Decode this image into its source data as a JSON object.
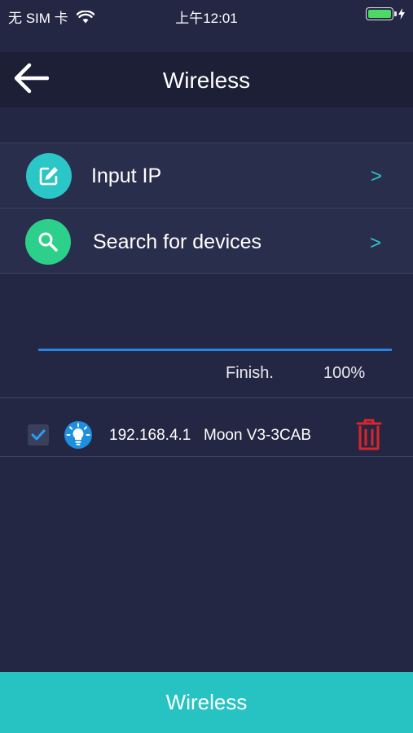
{
  "status_bar": {
    "carrier": "无 SIM 卡",
    "time": "上午12:01",
    "battery_level": 1.0
  },
  "header": {
    "title": "Wireless",
    "back_icon": "arrow-left-icon"
  },
  "menu": [
    {
      "label": "Input IP",
      "icon": "edit-icon",
      "chevron": ">",
      "color": "#2bc6c8"
    },
    {
      "label": "Search for devices",
      "icon": "search-icon",
      "chevron": ">",
      "color": "#2dd08a"
    }
  ],
  "progress": {
    "status": "Finish.",
    "percent_text": "100%",
    "value": 1.0,
    "color": "#2584e5"
  },
  "devices": [
    {
      "ip": "192.168.4.1",
      "name": "Moon V3-3CAB",
      "checked": true,
      "icon": "bulb-icon"
    }
  ],
  "bottom_button": {
    "label": "Wireless",
    "color": "#27c3c3"
  },
  "colors": {
    "background": "#242743",
    "delete": "#d9262b",
    "accent": "#27c3c3"
  }
}
